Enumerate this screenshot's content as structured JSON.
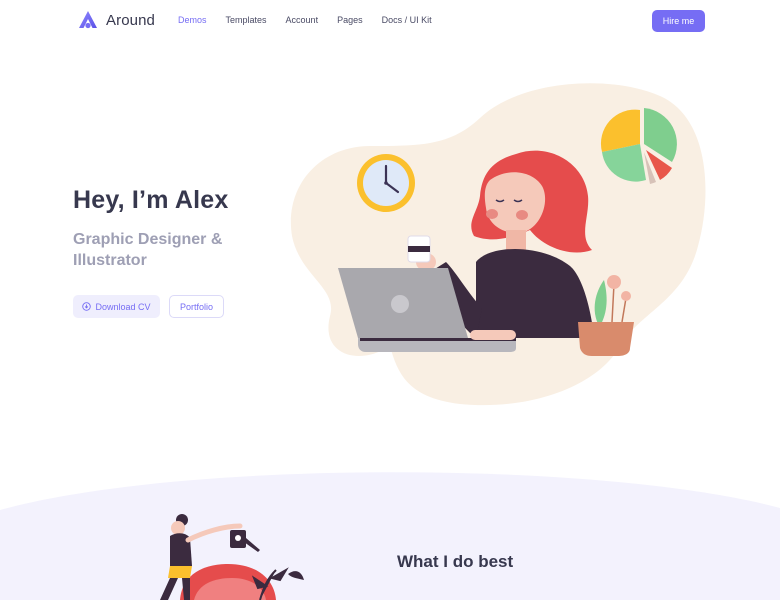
{
  "header": {
    "brand": "Around",
    "nav": [
      "Demos",
      "Templates",
      "Account",
      "Pages",
      "Docs / UI Kit"
    ],
    "active_nav": "Demos",
    "hire_label": "Hire me"
  },
  "hero": {
    "title": "Hey, I’m Alex",
    "subtitle": "Graphic Designer & Illustrator",
    "download_label": "Download CV",
    "portfolio_label": "Portfolio"
  },
  "section": {
    "title": "What I do best"
  },
  "colors": {
    "accent": "#766df4",
    "heading": "#37384e",
    "muted": "#9e9fb4",
    "blob": "#f9efe3",
    "section_bg": "#f3f2fd"
  },
  "icons": [
    "logo-mark-icon",
    "download-icon",
    "clock-icon",
    "pie-chart-icon",
    "laptop-icon",
    "plant-icon",
    "watering-can-icon"
  ]
}
